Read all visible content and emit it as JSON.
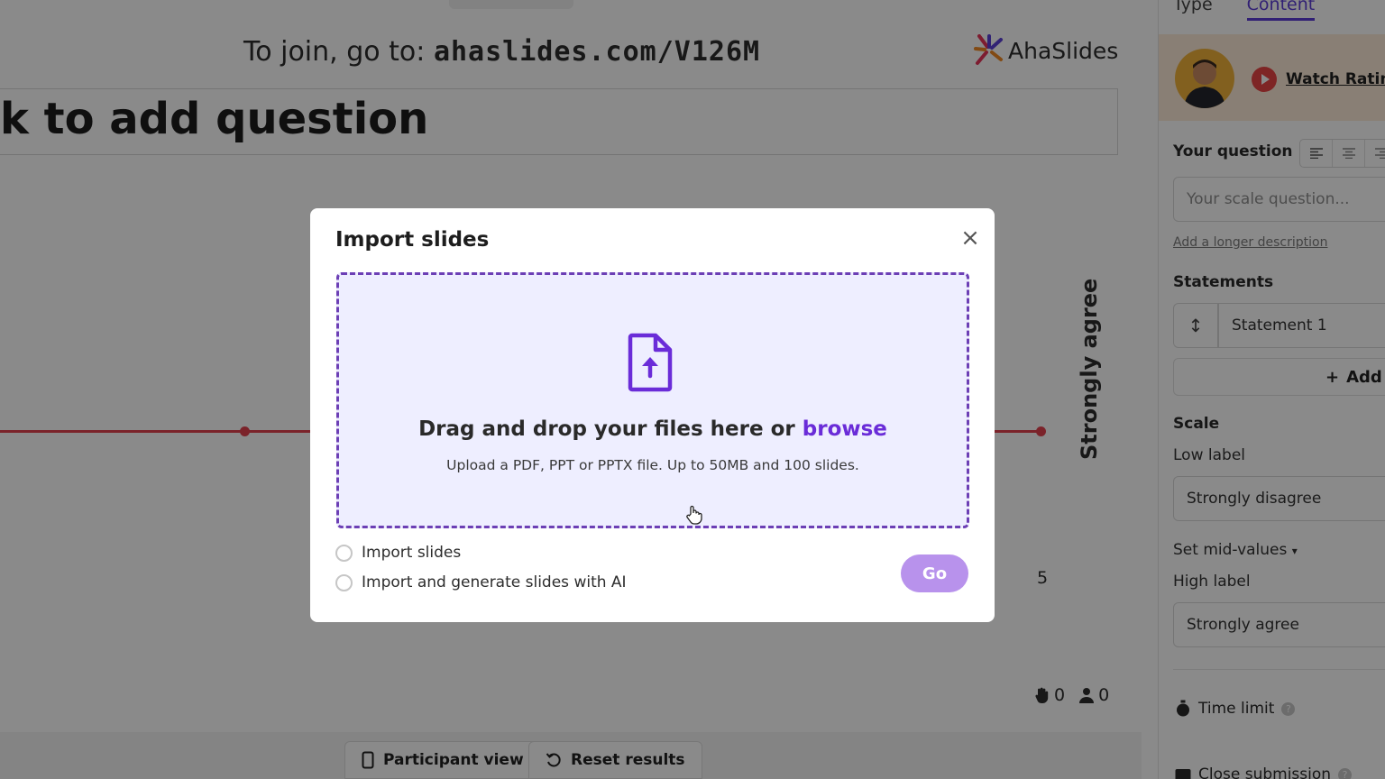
{
  "canvas": {
    "join_prefix": "To join, go to: ",
    "join_url": "ahaslides.com/V126M",
    "brand_name": "AhaSlides",
    "question_text": "k to add question",
    "high_label_vertical": "Strongly agree",
    "scale_max": "5",
    "reactions_count": "0",
    "participants_count": "0",
    "line_color": "#e4424f"
  },
  "bottom_bar": {
    "participant_view": "Participant view",
    "reset_results": "Reset results"
  },
  "panel": {
    "tabs": [
      "Type",
      "Content"
    ],
    "active_tab": "Content",
    "watch_link": "Watch Rating",
    "your_question_label": "Your question",
    "question_placeholder": "Your scale question...",
    "add_description": "Add a longer description",
    "statements_label": "Statements",
    "statement_1": "Statement 1",
    "add_label": "Add",
    "scale_label": "Scale",
    "low_label_title": "Low label",
    "low_label_value": "Strongly disagree",
    "mid_values": "Set mid-values",
    "high_label_title": "High label",
    "high_label_value": "Strongly agree",
    "time_limit": "Time limit",
    "close_submission": "Close submission",
    "accent": "#5c3bd6"
  },
  "modal": {
    "title": "Import slides",
    "drop_text": "Drag and drop your files here or ",
    "browse": "browse",
    "hint": "Upload a PDF, PPT or PPTX file. Up to 50MB and 100 slides.",
    "option_import": "Import slides",
    "option_ai": "Import and generate slides with AI",
    "go": "Go",
    "accent": "#6a2cd8",
    "go_color": "#b892ec"
  }
}
